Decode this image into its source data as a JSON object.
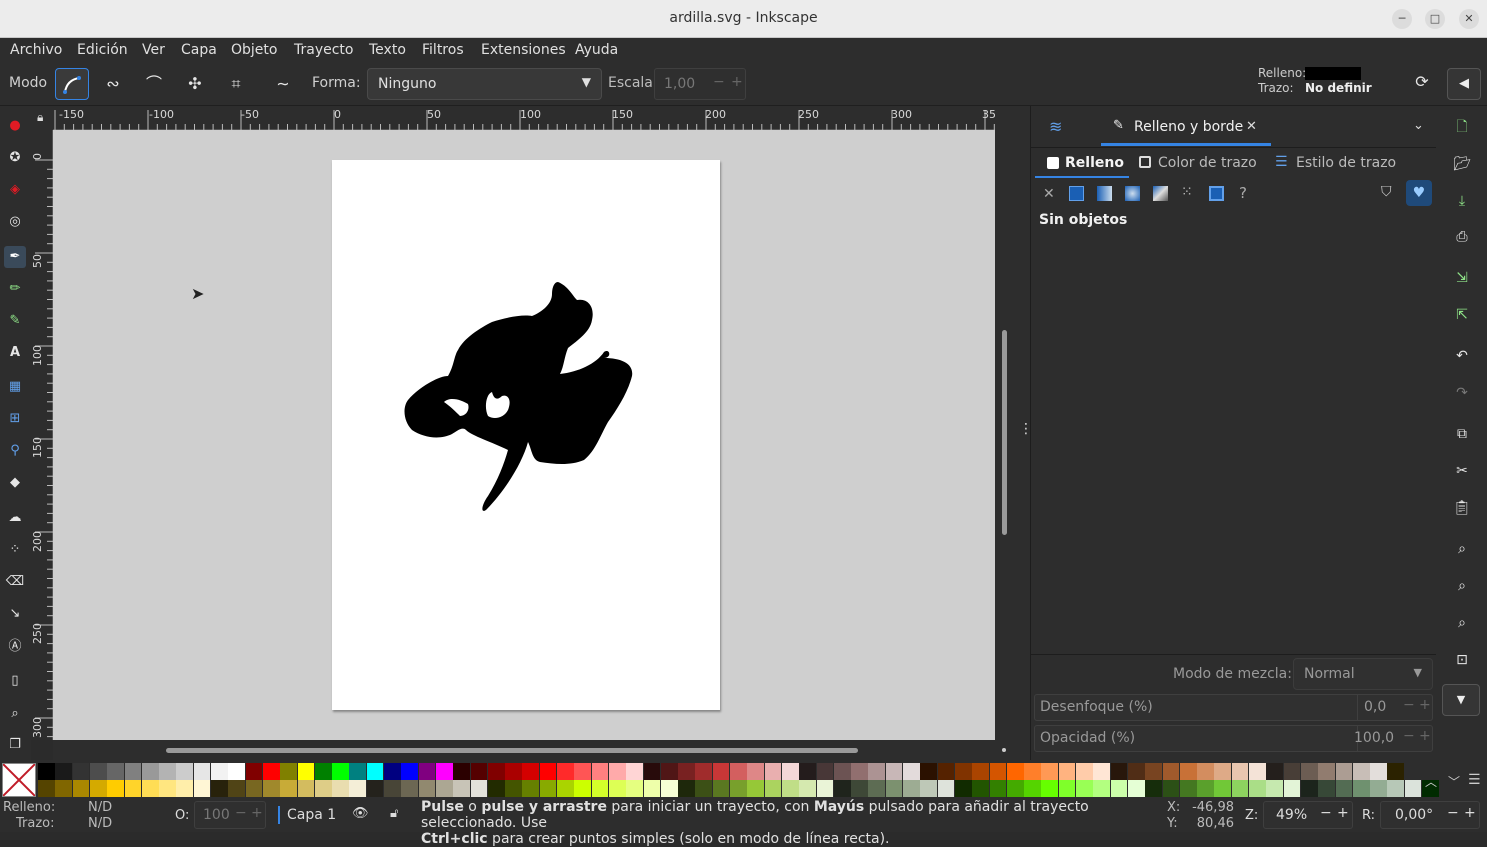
{
  "window": {
    "title": "ardilla.svg - Inkscape"
  },
  "menu": [
    "Archivo",
    "Edición",
    "Ver",
    "Capa",
    "Objeto",
    "Trayecto",
    "Texto",
    "Filtros",
    "Extensiones",
    "Ayuda"
  ],
  "toolbar": {
    "mode_label": "Modo",
    "shape_label": "Forma:",
    "shape_value": "Ninguno",
    "scale_label": "Escala:",
    "scale_value": "1,00",
    "fill_label": "Relleno:",
    "stroke_label": "Trazo:",
    "stroke_value": "No definir"
  },
  "ruler": {
    "h_ticks": [
      "-150",
      "-100",
      "-50",
      "0",
      "50",
      "100",
      "150",
      "200",
      "250",
      "300",
      "35"
    ],
    "v_ticks": [
      "0",
      "50",
      "100",
      "150",
      "200",
      "250",
      "300"
    ]
  },
  "panel": {
    "tab_label": "Relleno y borde",
    "subtabs": [
      "Relleno",
      "Color de trazo",
      "Estilo de trazo"
    ],
    "no_objects": "Sin objetos",
    "blend_label": "Modo de mezcla:",
    "blend_value": "Normal",
    "blur_label": "Desenfoque (%)",
    "blur_value": "0,0",
    "opacity_label": "Opacidad (%)",
    "opacity_value": "100,0"
  },
  "status": {
    "fill_label": "Relleno:",
    "fill_value": "N/D",
    "stroke_label": "Trazo:",
    "stroke_value": "N/D",
    "opacity_label": "O:",
    "opacity_value": "100",
    "layer": "Capa 1",
    "msg_b1": "Pulse",
    "msg_t1": " o ",
    "msg_b2": "pulse y arrastre",
    "msg_t2": " para iniciar un trayecto, con ",
    "msg_b3": "Mayús",
    "msg_t3": " pulsado para añadir al trayecto seleccionado. Use",
    "msg_b4": "Ctrl+clic",
    "msg_t4": " para crear puntos simples (solo en modo de línea recta).",
    "x_label": "X:",
    "x_value": "-46,98",
    "y_label": "Y:",
    "y_value": "80,46",
    "zoom_label": "Z:",
    "zoom_value": "49%",
    "rot_label": "R:",
    "rot_value": "0,00°"
  },
  "colors": {
    "accent": "#3584e4",
    "panel_bg": "#2d2d2d",
    "canvas_bg": "#cfcfcf"
  }
}
